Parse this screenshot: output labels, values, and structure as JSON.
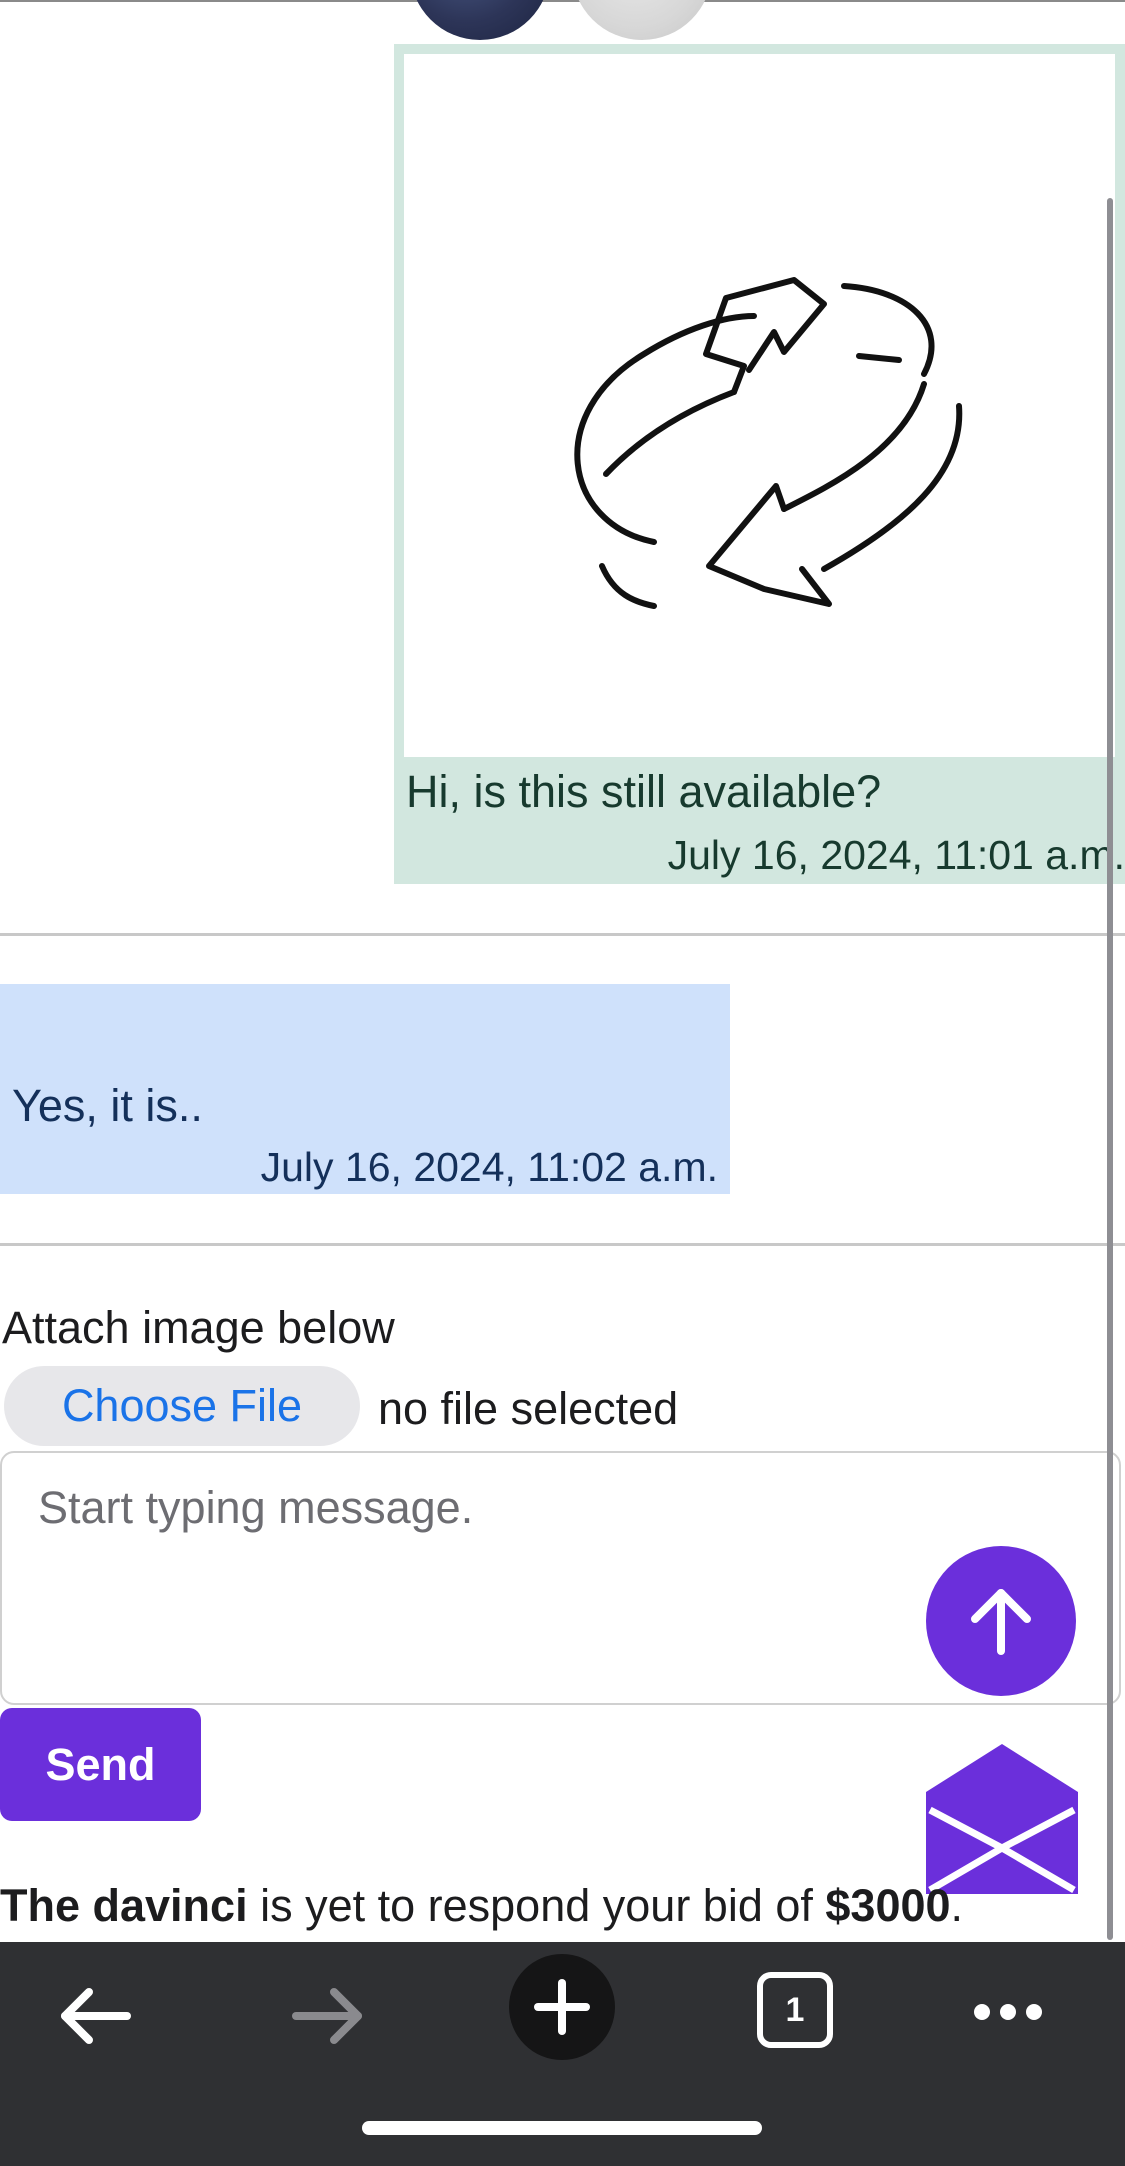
{
  "messages": {
    "sent": {
      "text": "Hi, is this still available?",
      "time": "July 16, 2024, 11:01 a.m."
    },
    "received": {
      "text": "Yes, it is..",
      "time": "July 16, 2024, 11:02 a.m."
    }
  },
  "composer": {
    "attach_label": "Attach image below",
    "choose_file": "Choose File",
    "no_file": "no file selected",
    "placeholder": "Start typing message.",
    "send_label": "Send"
  },
  "status": {
    "name": "The davinci",
    "middle": " is yet to respond your bid of ",
    "amount": "$3000",
    "end": "."
  },
  "browser_toolbar": {
    "tab_count": "1",
    "icons": [
      "back-arrow-icon",
      "forward-arrow-icon",
      "new-tab-plus-icon",
      "tabs-icon",
      "more-icon"
    ]
  },
  "colors": {
    "accent": "#6b2fdb",
    "sent_bubble": "#d2e7df",
    "received_bubble": "#cfe1fb",
    "link_blue": "#1a73e8",
    "toolbar_bg": "#2f3033"
  }
}
